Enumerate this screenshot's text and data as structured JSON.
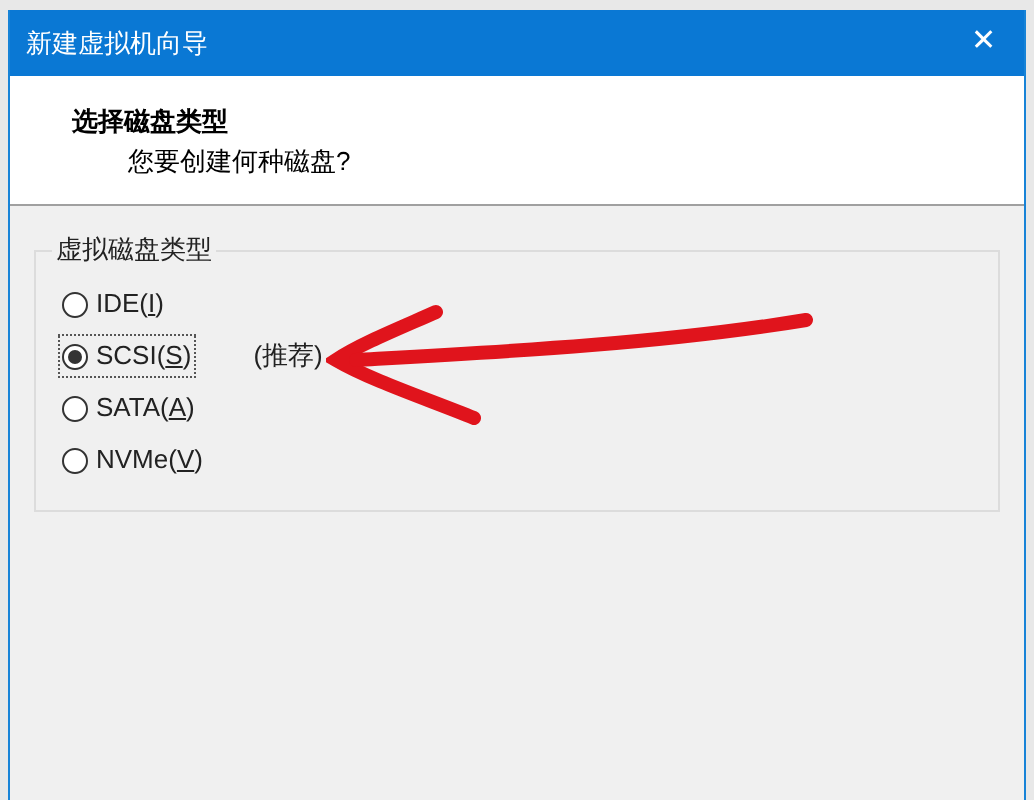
{
  "window": {
    "title": "新建虚拟机向导",
    "close": "✕"
  },
  "header": {
    "title": "选择磁盘类型",
    "subtitle": "您要创建何种磁盘?"
  },
  "group": {
    "title": "虚拟磁盘类型",
    "options": [
      {
        "text_before": "IDE(",
        "access_key": "I",
        "text_after": ")",
        "selected": false
      },
      {
        "text_before": "SCSI(",
        "access_key": "S",
        "text_after": ")",
        "selected": true,
        "note": "(推荐)"
      },
      {
        "text_before": "SATA(",
        "access_key": "A",
        "text_after": ")",
        "selected": false
      },
      {
        "text_before": "NVMe(",
        "access_key": "V",
        "text_after": ")",
        "selected": false
      }
    ]
  }
}
